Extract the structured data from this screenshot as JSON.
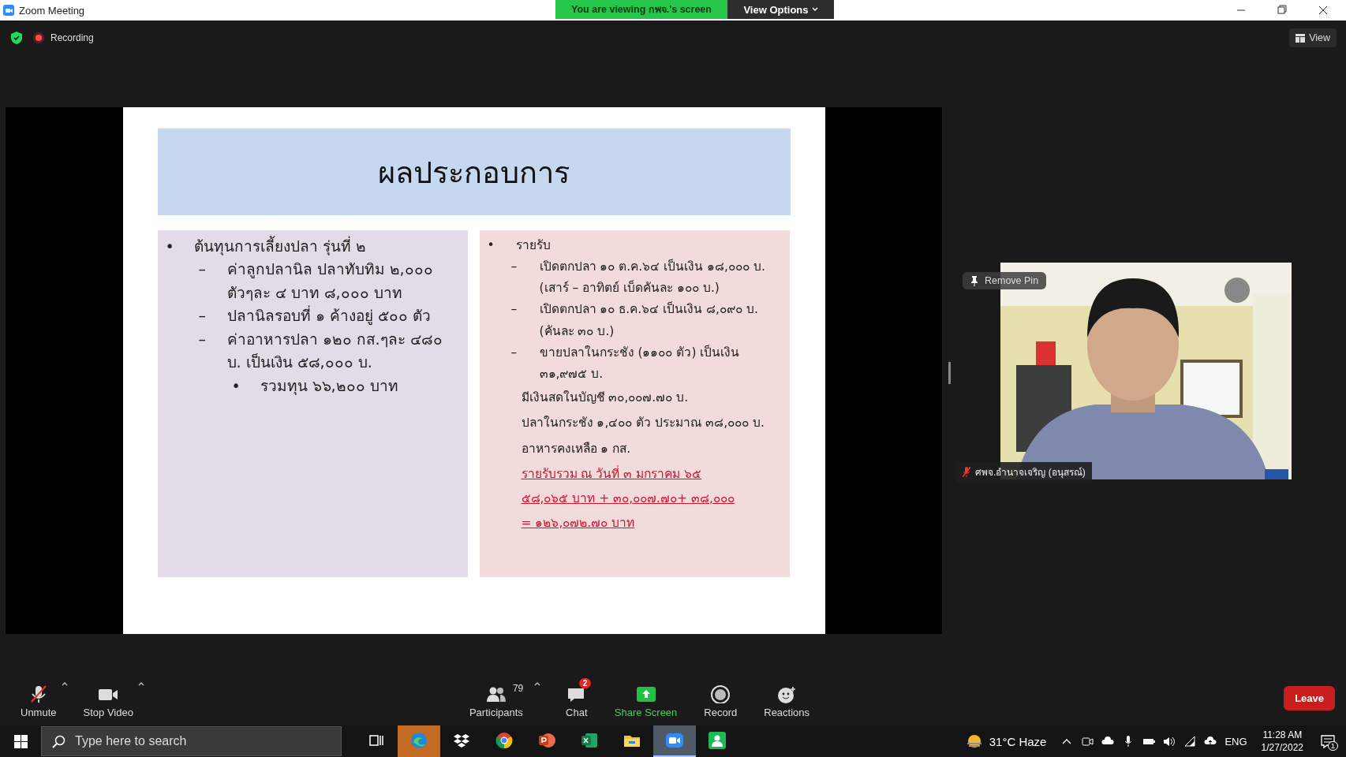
{
  "window": {
    "title": "Zoom Meeting"
  },
  "share_banner": {
    "text": "You are viewing กพจ.'s screen",
    "view_options": "View Options"
  },
  "topbar": {
    "recording": "Recording",
    "view": "View"
  },
  "slide": {
    "title": "ผลประกอบการ",
    "left": [
      {
        "marker": "•",
        "text": "ต้นทุนการเลี้ยงปลา รุ่นที่ ๒",
        "children": [
          {
            "marker": "–",
            "text": "ค่าลูกปลานิล ปลาทับทิม ๒,๐๐๐ ตัวๆละ ๔ บาท  ๘,๐๐๐  บาท"
          },
          {
            "marker": "–",
            "text": "ปลานิลรอบที่ ๑ ค้างอยู่ ๕๐๐ ตัว"
          },
          {
            "marker": "–",
            "text": "ค่าอาหารปลา ๑๒๐ กส.ๆละ ๔๘๐ บ. เป็นเงิน  ๕๘,๐๐๐ บ.",
            "children": [
              {
                "marker": "•",
                "text": "รวมทุน    ๖๖,๒๐๐ บาท"
              }
            ]
          }
        ]
      }
    ],
    "right": [
      {
        "kind": "item",
        "marker": "•",
        "text": "รายรับ",
        "children": [
          {
            "marker": "–",
            "text": "เปิดตกปลา ๑๐ ต.ค.๖๔ เป็นเงิน ๑๘,๐๐๐ บ.(เสาร์ – อาทิตย์ เบ็ดคันละ ๑๐๐ บ.)"
          },
          {
            "marker": "–",
            "text": "เปิดตกปลา ๑๐ ธ.ค.๖๔ เป็นเงิน ๘,๐๙๐ บ. (คันละ ๓๐ บ.)"
          },
          {
            "marker": "–",
            "text": "ขายปลาในกระชัง (๑๑๐๐ ตัว) เป็นเงิน ๓๑,๙๗๕ บ."
          }
        ]
      },
      {
        "kind": "line",
        "text": "มีเงินสดในบัญชี ๓๐,๐๐๗.๗๐ บ."
      },
      {
        "kind": "line",
        "text": "ปลาในกระชัง ๑,๔๐๐ ตัว ประมาณ ๓๘,๐๐๐ บ."
      },
      {
        "kind": "line",
        "text": "อาหารคงเหลือ ๑ กส."
      },
      {
        "kind": "total",
        "text": "รายรับรวม  ณ วันที่ ๓ มกราคม ๖๕"
      },
      {
        "kind": "total",
        "text": "๕๘,๐๖๕  บาท    + ๓๐,๐๐๗.๗๐+ ๓๘,๐๐๐"
      },
      {
        "kind": "total",
        "text": "= ๑๒๖,๐๗๒.๗๐ บาท"
      }
    ]
  },
  "video": {
    "remove_pin": "Remove Pin",
    "name": "ศพจ.อำนาจเจริญ (อนุสรณ์)",
    "muted": true
  },
  "toolbar": [
    {
      "kind": "mic",
      "label": "Unmute",
      "muted": true,
      "caret": true
    },
    {
      "kind": "video",
      "label": "Stop Video",
      "caret": true
    },
    {
      "kind": "participants",
      "label": "Participants",
      "count": "79",
      "caret": true
    },
    {
      "kind": "chat",
      "label": "Chat",
      "badge": "2"
    },
    {
      "kind": "share",
      "label": "Share Screen"
    },
    {
      "kind": "record",
      "label": "Record"
    },
    {
      "kind": "reactions",
      "label": "Reactions"
    }
  ],
  "leave": "Leave",
  "taskbar": {
    "search": {
      "placeholder": "Type here to search"
    },
    "apps": [
      {
        "kind": "taskview",
        "selected": false,
        "flashing": false
      },
      {
        "kind": "edge",
        "selected": false,
        "flashing": true
      },
      {
        "kind": "dropbox",
        "selected": false,
        "flashing": false
      },
      {
        "kind": "chrome",
        "selected": false,
        "flashing": false
      },
      {
        "kind": "powerpoint",
        "selected": false,
        "flashing": false
      },
      {
        "kind": "excel",
        "selected": false,
        "flashing": false
      },
      {
        "kind": "explorer",
        "selected": false,
        "flashing": false
      },
      {
        "kind": "zoom",
        "selected": true,
        "flashing": false
      },
      {
        "kind": "contacts",
        "selected": false,
        "flashing": false
      }
    ],
    "weather": "31°C  Haze",
    "language": "ENG",
    "time": "11:28 AM",
    "date": "1/27/2022",
    "notifications": "1"
  }
}
